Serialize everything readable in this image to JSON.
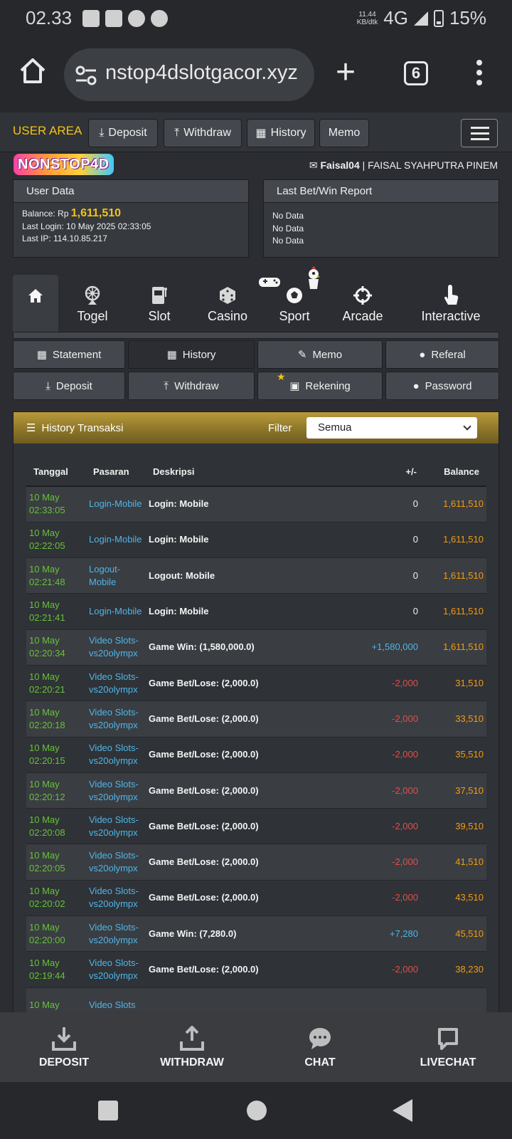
{
  "status": {
    "time": "02.33",
    "net_speed": "11.44\nKB/dtk",
    "network": "4G",
    "battery": "15%"
  },
  "browser": {
    "url": "nstop4dslotgacor.xyz",
    "tab_count": "6"
  },
  "topnav": {
    "user_area": "USER AREA",
    "deposit": "Deposit",
    "withdraw": "Withdraw",
    "history": "History",
    "memo": "Memo"
  },
  "brand": {
    "logo_text": "NONSTOP4D"
  },
  "user": {
    "username": "Faisal04",
    "separator": "|",
    "fullname": "FAISAL SYAHPUTRA PINEM"
  },
  "user_data": {
    "title": "User Data",
    "balance_label": "Balance: Rp",
    "balance": "1,611,510",
    "last_login": "Last Login: 10 May 2025 02:33:05",
    "last_ip": "Last IP: 114.10.85.217"
  },
  "report": {
    "title": "Last Bet/Win Report",
    "lines": [
      "No Data",
      "No Data",
      "No Data"
    ]
  },
  "categories": [
    "Togel",
    "Slot",
    "Casino",
    "Sport",
    "Arcade",
    "Interactive"
  ],
  "submenu": {
    "statement": "Statement",
    "history": "History",
    "memo": "Memo",
    "referal": "Referal",
    "deposit": "Deposit",
    "withdraw": "Withdraw",
    "rekening": "Rekening",
    "password": "Password"
  },
  "history": {
    "title": "History Transaksi",
    "filter_label": "Filter",
    "filter_value": "Semua",
    "columns": [
      "Tanggal",
      "Pasaran",
      "Deskripsi",
      "+/-",
      "Balance"
    ],
    "rows": [
      {
        "date": "10 May",
        "time": "02:33:05",
        "pasaran": "Login-Mobile",
        "desc": "Login: Mobile",
        "amount": "0",
        "balance": "1,611,510"
      },
      {
        "date": "10 May",
        "time": "02:22:05",
        "pasaran": "Login-Mobile",
        "desc": "Login: Mobile",
        "amount": "0",
        "balance": "1,611,510"
      },
      {
        "date": "10 May",
        "time": "02:21:48",
        "pasaran": "Logout-Mobile",
        "desc": "Logout: Mobile",
        "amount": "0",
        "balance": "1,611,510"
      },
      {
        "date": "10 May",
        "time": "02:21:41",
        "pasaran": "Login-Mobile",
        "desc": "Login: Mobile",
        "amount": "0",
        "balance": "1,611,510"
      },
      {
        "date": "10 May",
        "time": "02:20:34",
        "pasaran": "Video Slots-vs20olympx",
        "desc": "Game Win: (1,580,000.0)",
        "amount": "+1,580,000",
        "balance": "1,611,510"
      },
      {
        "date": "10 May",
        "time": "02:20:21",
        "pasaran": "Video Slots-vs20olympx",
        "desc": "Game Bet/Lose: (2,000.0)",
        "amount": "-2,000",
        "balance": "31,510"
      },
      {
        "date": "10 May",
        "time": "02:20:18",
        "pasaran": "Video Slots-vs20olympx",
        "desc": "Game Bet/Lose: (2,000.0)",
        "amount": "-2,000",
        "balance": "33,510"
      },
      {
        "date": "10 May",
        "time": "02:20:15",
        "pasaran": "Video Slots-vs20olympx",
        "desc": "Game Bet/Lose: (2,000.0)",
        "amount": "-2,000",
        "balance": "35,510"
      },
      {
        "date": "10 May",
        "time": "02:20:12",
        "pasaran": "Video Slots-vs20olympx",
        "desc": "Game Bet/Lose: (2,000.0)",
        "amount": "-2,000",
        "balance": "37,510"
      },
      {
        "date": "10 May",
        "time": "02:20:08",
        "pasaran": "Video Slots-vs20olympx",
        "desc": "Game Bet/Lose: (2,000.0)",
        "amount": "-2,000",
        "balance": "39,510"
      },
      {
        "date": "10 May",
        "time": "02:20:05",
        "pasaran": "Video Slots-vs20olympx",
        "desc": "Game Bet/Lose: (2,000.0)",
        "amount": "-2,000",
        "balance": "41,510"
      },
      {
        "date": "10 May",
        "time": "02:20:02",
        "pasaran": "Video Slots-vs20olympx",
        "desc": "Game Bet/Lose: (2,000.0)",
        "amount": "-2,000",
        "balance": "43,510"
      },
      {
        "date": "10 May",
        "time": "02:20:00",
        "pasaran": "Video Slots-vs20olympx",
        "desc": "Game Win: (7,280.0)",
        "amount": "+7,280",
        "balance": "45,510"
      },
      {
        "date": "10 May",
        "time": "02:19:44",
        "pasaran": "Video Slots-vs20olympx",
        "desc": "Game Bet/Lose: (2,000.0)",
        "amount": "-2,000",
        "balance": "38,230"
      },
      {
        "date": "10 May",
        "time": "",
        "pasaran": "Video Slots",
        "desc": "",
        "amount": "",
        "balance": ""
      }
    ]
  },
  "bottomnav": {
    "deposit": "DEPOSIT",
    "withdraw": "WITHDRAW",
    "chat": "CHAT",
    "livechat": "LIVECHAT"
  },
  "colors": {
    "accent": "#f3c316",
    "positive": "#4fb6e8",
    "negative": "#e0504a",
    "balance": "#f39c12",
    "date": "#67c23a"
  }
}
